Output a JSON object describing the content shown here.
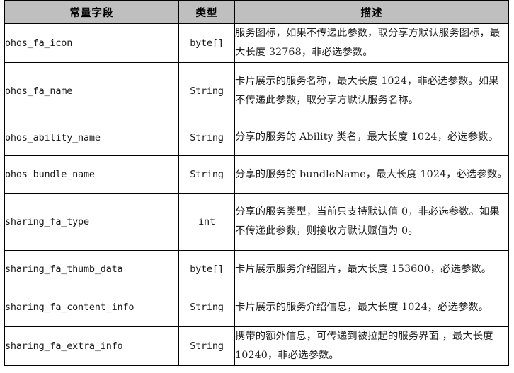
{
  "table": {
    "headers": {
      "field": "常量字段",
      "type": "类型",
      "description": "描述"
    },
    "header_background": "#bfbfbf",
    "border_color": "#000000",
    "rows": [
      {
        "field": "ohos_fa_icon",
        "type": "byte[]",
        "description": "服务图标，如果不传递此参数，取分享方默认服务图标，最大长度 32768，非必选参数。"
      },
      {
        "field": "ohos_fa_name",
        "type": "String",
        "description": "卡片展示的服务名称，最大长度 1024，非必选参数。如果不传递此参数，取分享方默认服务名称。"
      },
      {
        "field": "ohos_ability_name",
        "type": "String",
        "description": "分享的服务的 Ability 类名，最大长度 1024，必选参数。"
      },
      {
        "field": "ohos_bundle_name",
        "type": "String",
        "description": "分享的服务的 bundleName，最大长度 1024，必选参数。"
      },
      {
        "field": "sharing_fa_type",
        "type": "int",
        "description": "分享的服务类型，当前只支持默认值 0，非必选参数。如果不传递此参数，则接收方默认赋值为 0。"
      },
      {
        "field": "sharing_fa_thumb_data",
        "type": "byte[]",
        "description": "卡片展示服务介绍图片，最大长度 153600，必选参数。"
      },
      {
        "field": "sharing_fa_content_info",
        "type": "String",
        "description": "卡片展示的服务介绍信息，最大长度 1024，必选参数。"
      },
      {
        "field": "sharing_fa_extra_info",
        "type": "String",
        "description": "携带的额外信息，可传递到被拉起的服务界面 ，最大长度 10240，非必选参数。"
      }
    ]
  }
}
